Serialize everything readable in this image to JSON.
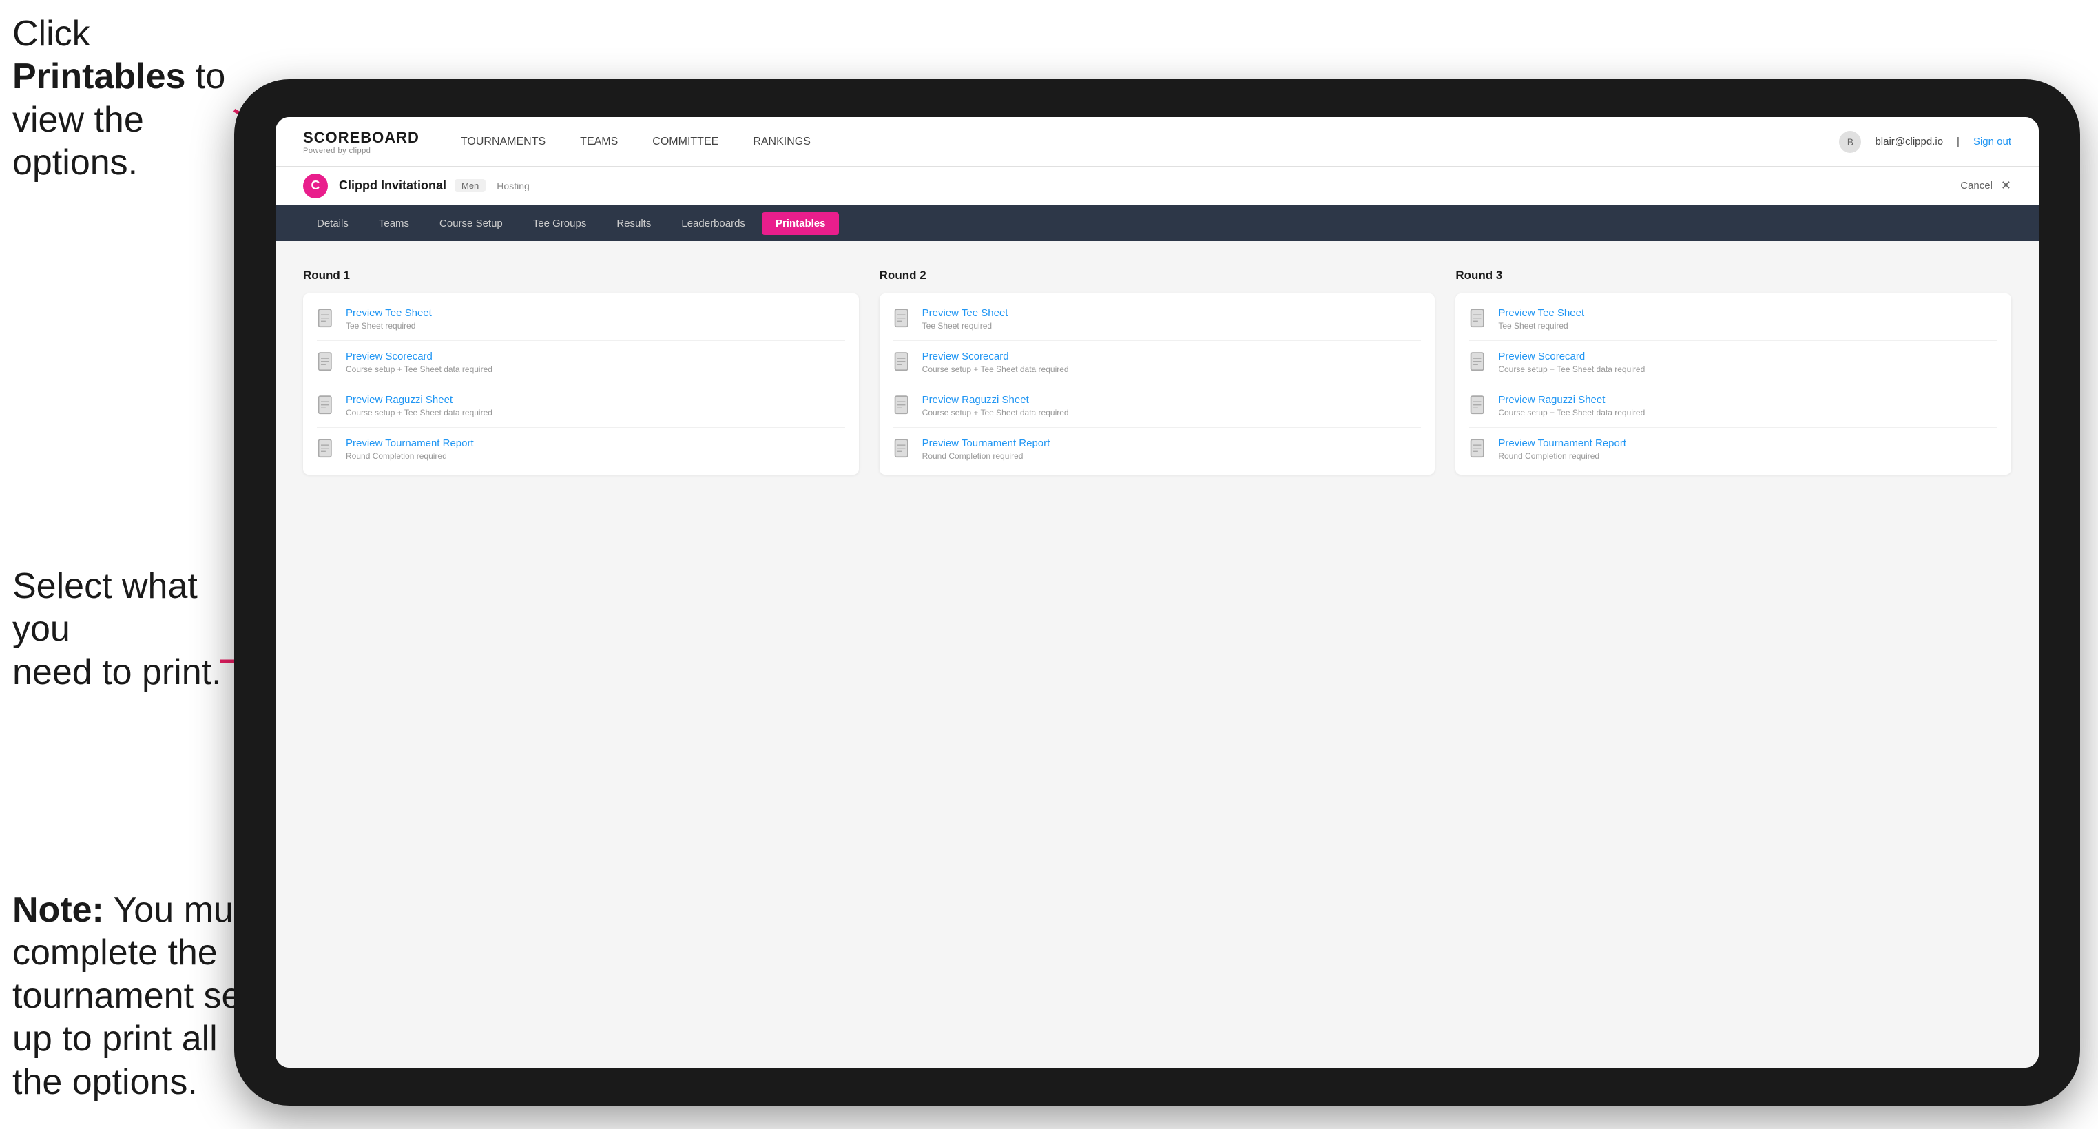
{
  "annotations": {
    "top_text_line1": "Click ",
    "top_text_bold": "Printables",
    "top_text_line2": " to",
    "top_text_line3": "view the options.",
    "middle_text_line1": "Select what you",
    "middle_text_line2": "need to print.",
    "bottom_text_line1": "Note:",
    "bottom_text_line2": " You must complete the tournament set-up to print all the options."
  },
  "top_nav": {
    "logo_main": "SCOREBOARD",
    "logo_sub": "Powered by clippd",
    "links": [
      {
        "label": "TOURNAMENTS",
        "active": false
      },
      {
        "label": "TEAMS",
        "active": false
      },
      {
        "label": "COMMITTEE",
        "active": false
      },
      {
        "label": "RANKINGS",
        "active": false
      }
    ],
    "user_email": "blair@clippd.io",
    "sign_out": "Sign out"
  },
  "tournament_header": {
    "logo_letter": "C",
    "title": "Clippd Invitational",
    "badge": "Men",
    "status": "Hosting",
    "cancel": "Cancel"
  },
  "sub_nav": {
    "tabs": [
      {
        "label": "Details",
        "active": false
      },
      {
        "label": "Teams",
        "active": false
      },
      {
        "label": "Course Setup",
        "active": false
      },
      {
        "label": "Tee Groups",
        "active": false
      },
      {
        "label": "Results",
        "active": false
      },
      {
        "label": "Leaderboards",
        "active": false
      },
      {
        "label": "Printables",
        "active": true
      }
    ]
  },
  "rounds": [
    {
      "title": "Round 1",
      "items": [
        {
          "title": "Preview Tee Sheet",
          "subtitle": "Tee Sheet required"
        },
        {
          "title": "Preview Scorecard",
          "subtitle": "Course setup + Tee Sheet data required"
        },
        {
          "title": "Preview Raguzzi Sheet",
          "subtitle": "Course setup + Tee Sheet data required"
        },
        {
          "title": "Preview Tournament Report",
          "subtitle": "Round Completion required"
        }
      ]
    },
    {
      "title": "Round 2",
      "items": [
        {
          "title": "Preview Tee Sheet",
          "subtitle": "Tee Sheet required"
        },
        {
          "title": "Preview Scorecard",
          "subtitle": "Course setup + Tee Sheet data required"
        },
        {
          "title": "Preview Raguzzi Sheet",
          "subtitle": "Course setup + Tee Sheet data required"
        },
        {
          "title": "Preview Tournament Report",
          "subtitle": "Round Completion required"
        }
      ]
    },
    {
      "title": "Round 3",
      "items": [
        {
          "title": "Preview Tee Sheet",
          "subtitle": "Tee Sheet required"
        },
        {
          "title": "Preview Scorecard",
          "subtitle": "Course setup + Tee Sheet data required"
        },
        {
          "title": "Preview Raguzzi Sheet",
          "subtitle": "Course setup + Tee Sheet data required"
        },
        {
          "title": "Preview Tournament Report",
          "subtitle": "Round Completion required"
        }
      ]
    }
  ]
}
